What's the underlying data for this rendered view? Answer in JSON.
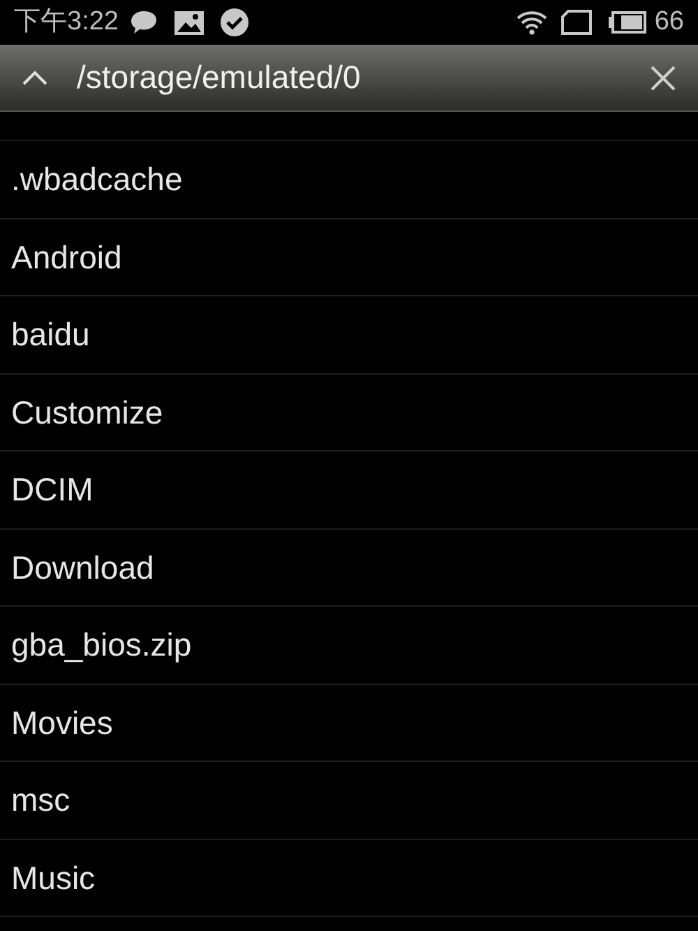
{
  "status_bar": {
    "time": "下午3:22",
    "battery": "66"
  },
  "path_bar": {
    "path": "/storage/emulated/0"
  },
  "files": [
    {
      "name": ".wbadcache"
    },
    {
      "name": "Android"
    },
    {
      "name": "baidu"
    },
    {
      "name": "Customize"
    },
    {
      "name": "DCIM"
    },
    {
      "name": "Download"
    },
    {
      "name": "gba_bios.zip"
    },
    {
      "name": "Movies"
    },
    {
      "name": "msc"
    },
    {
      "name": "Music"
    }
  ]
}
